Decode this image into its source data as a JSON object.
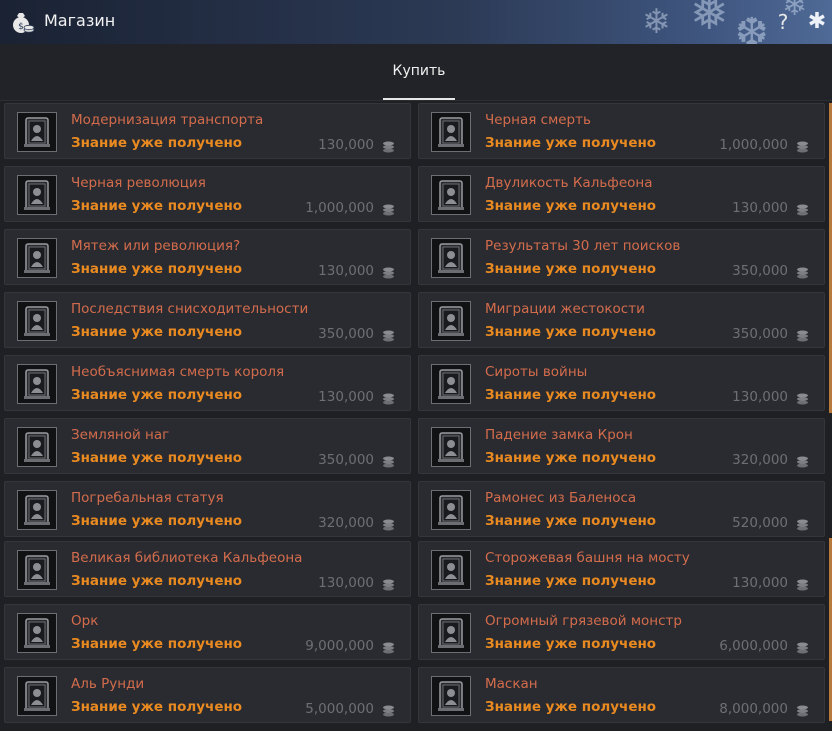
{
  "window": {
    "title": "Магазин",
    "icon": "money-bag-icon",
    "help_glyph": "?",
    "settings_glyph": "✱"
  },
  "tabs": [
    {
      "label": "Купить",
      "active": true
    }
  ],
  "colors": {
    "item_name": "#d36c4c",
    "item_status": "#e98a21",
    "item_price": "#6e6f75",
    "titlebar_accent": "#4f6a96"
  },
  "items": [
    {
      "name": "Модернизация транспорта",
      "status": "Знание уже получено",
      "price": "130,000",
      "icon": "knowledge-book-icon"
    },
    {
      "name": "Черная смерть",
      "status": "Знание уже получено",
      "price": "1,000,000",
      "icon": "knowledge-book-icon"
    },
    {
      "name": "Черная революция",
      "status": "Знание уже получено",
      "price": "1,000,000",
      "icon": "knowledge-book-icon"
    },
    {
      "name": "Двуликость Кальфеона",
      "status": "Знание уже получено",
      "price": "130,000",
      "icon": "knowledge-book-icon"
    },
    {
      "name": "Мятеж или революция?",
      "status": "Знание уже получено",
      "price": "130,000",
      "icon": "knowledge-book-icon"
    },
    {
      "name": "Результаты 30 лет поисков",
      "status": "Знание уже получено",
      "price": "350,000",
      "icon": "knowledge-book-icon"
    },
    {
      "name": "Последствия снисходительности",
      "status": "Знание уже получено",
      "price": "350,000",
      "icon": "knowledge-book-icon"
    },
    {
      "name": "Миграции жестокости",
      "status": "Знание уже получено",
      "price": "350,000",
      "icon": "knowledge-book-icon"
    },
    {
      "name": "Необъяснимая смерть короля",
      "status": "Знание уже получено",
      "price": "130,000",
      "icon": "knowledge-book-icon"
    },
    {
      "name": "Сироты войны",
      "status": "Знание уже получено",
      "price": "130,000",
      "icon": "knowledge-book-icon"
    },
    {
      "name": "Земляной наг",
      "status": "Знание уже получено",
      "price": "350,000",
      "icon": "knowledge-book-icon"
    },
    {
      "name": "Падение замка Крон",
      "status": "Знание уже получено",
      "price": "320,000",
      "icon": "knowledge-book-icon"
    },
    {
      "name": "Погребальная статуя",
      "status": "Знание уже получено",
      "price": "320,000",
      "icon": "knowledge-book-icon"
    },
    {
      "name": "Рамонес из Баленоса",
      "status": "Знание уже получено",
      "price": "520,000",
      "icon": "knowledge-book-icon"
    },
    {
      "name": "Великая библиотека Кальфеона",
      "status": "Знание уже получено",
      "price": "130,000",
      "icon": "knowledge-book-icon"
    },
    {
      "name": "Сторожевая башня на мосту",
      "status": "Знание уже получено",
      "price": "130,000",
      "icon": "knowledge-book-icon"
    },
    {
      "name": "Орк",
      "status": "Знание уже получено",
      "price": "9,000,000",
      "icon": "knowledge-book-icon"
    },
    {
      "name": "Огромный грязевой монстр",
      "status": "Знание уже получено",
      "price": "6,000,000",
      "icon": "knowledge-book-icon"
    },
    {
      "name": "Аль Рунди",
      "status": "Знание уже получено",
      "price": "5,000,000",
      "icon": "knowledge-book-icon"
    },
    {
      "name": "Маскан",
      "status": "Знание уже получено",
      "price": "8,000,000",
      "icon": "knowledge-book-icon"
    }
  ]
}
